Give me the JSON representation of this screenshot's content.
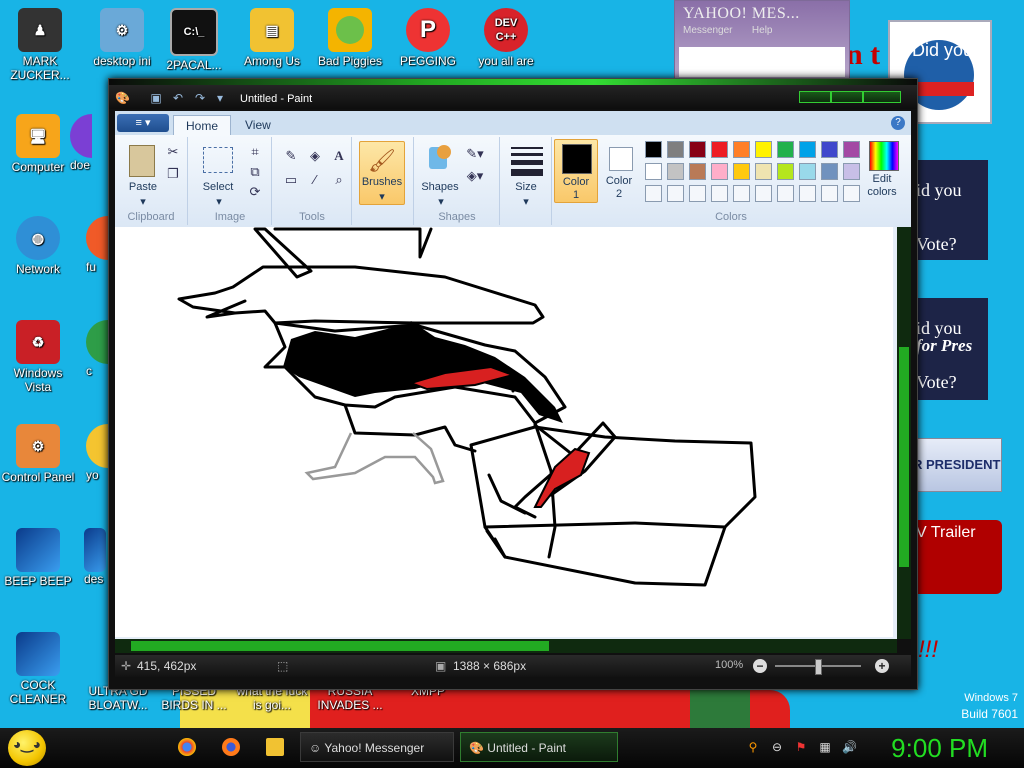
{
  "desktop": {
    "icons": [
      {
        "label": "MARK ZUCKER...",
        "icon": "person-figure-icon"
      },
      {
        "label": "desktop ini",
        "icon": "settings-file-icon"
      },
      {
        "label": "2PACAL...",
        "icon": "terminal-icon"
      },
      {
        "label": "Among Us",
        "icon": "folder-icon"
      },
      {
        "label": "Bad Piggies",
        "icon": "pig-icon"
      },
      {
        "label": "PEGGING",
        "icon": "p-logo-icon"
      },
      {
        "label": "you all are",
        "icon": "dev-cpp-icon"
      },
      {
        "label": "Computer",
        "icon": "computer-icon"
      },
      {
        "label": "doe",
        "icon": "app-icon"
      },
      {
        "label": "Network",
        "icon": "network-globe-icon"
      },
      {
        "label": "fu",
        "icon": "app-icon"
      },
      {
        "label": "Windows Vista",
        "icon": "recycle-bin-icon"
      },
      {
        "label": "c",
        "icon": "chrome-icon"
      },
      {
        "label": "Control Panel",
        "icon": "control-panel-icon"
      },
      {
        "label": "yo",
        "icon": "app-icon"
      },
      {
        "label": "BEEP BEEP",
        "icon": "blue-doc-icon"
      },
      {
        "label": "des",
        "icon": "blue-doc-icon"
      },
      {
        "label": "COCK CLEANER",
        "icon": "blue-doc-icon"
      },
      {
        "label": "ULTRA GD BLOATW...",
        "icon": "app-icon"
      },
      {
        "label": "PISSED BIRDS IN ...",
        "icon": "app-icon"
      },
      {
        "label": "what the fuck is goi...",
        "icon": "app-icon"
      },
      {
        "label": "RUSSIA INVADES ...",
        "icon": "app-icon"
      },
      {
        "label": "XMPP",
        "icon": "app-icon"
      }
    ],
    "wallpaper_texts": {
      "did_you_1": "Did you",
      "did_you_2": "id you",
      "vote_1": "Vote?",
      "did_you_3": "id you",
      "for_pres": "for Pres",
      "vote_2": "Vote?",
      "president": "R PRESIDENT",
      "trailer": "V Trailer",
      "red_big": "n t",
      "exclaim": "!!!"
    },
    "watermark": {
      "line1": "Windows 7",
      "line2": "Build 7601"
    }
  },
  "yahoo": {
    "title": "YAHOO! MES...",
    "menu": [
      "Messenger",
      "Help"
    ]
  },
  "paint": {
    "title": "Untitled - Paint",
    "tabs": {
      "file": "≡ ▾",
      "home": "Home",
      "view": "View"
    },
    "clipboard": {
      "paste": "Paste",
      "label": "Clipboard"
    },
    "image": {
      "select": "Select",
      "label": "Image"
    },
    "tools": {
      "label": "Tools"
    },
    "brushes": {
      "label": "Brushes"
    },
    "shapes": {
      "shapes": "Shapes",
      "label": "Shapes"
    },
    "size": {
      "label": "Size"
    },
    "color1": {
      "line1": "Color",
      "line2": "1"
    },
    "color2": {
      "line1": "Color",
      "line2": "2"
    },
    "colors": {
      "label": "Colors",
      "edit_line1": "Edit",
      "edit_line2": "colors"
    },
    "palette_row1": [
      "#000000",
      "#7f7f7f",
      "#880015",
      "#ed1c24",
      "#ff7f27",
      "#fff200",
      "#22b14c",
      "#00a2e8",
      "#3f48cc",
      "#a349a4"
    ],
    "palette_row2": [
      "#ffffff",
      "#c3c3c3",
      "#b97a57",
      "#ffaec9",
      "#ffc90e",
      "#efe4b0",
      "#b5e61d",
      "#99d9ea",
      "#7092be",
      "#c8bfe7"
    ],
    "status": {
      "cursor": "415, 462px",
      "size": "1388 × 686px",
      "zoom": "100%"
    }
  },
  "taskbar": {
    "tasks": [
      {
        "label": "Yahoo! Messenger"
      },
      {
        "label": "Untitled - Paint"
      }
    ],
    "clock": "9:00 PM"
  }
}
